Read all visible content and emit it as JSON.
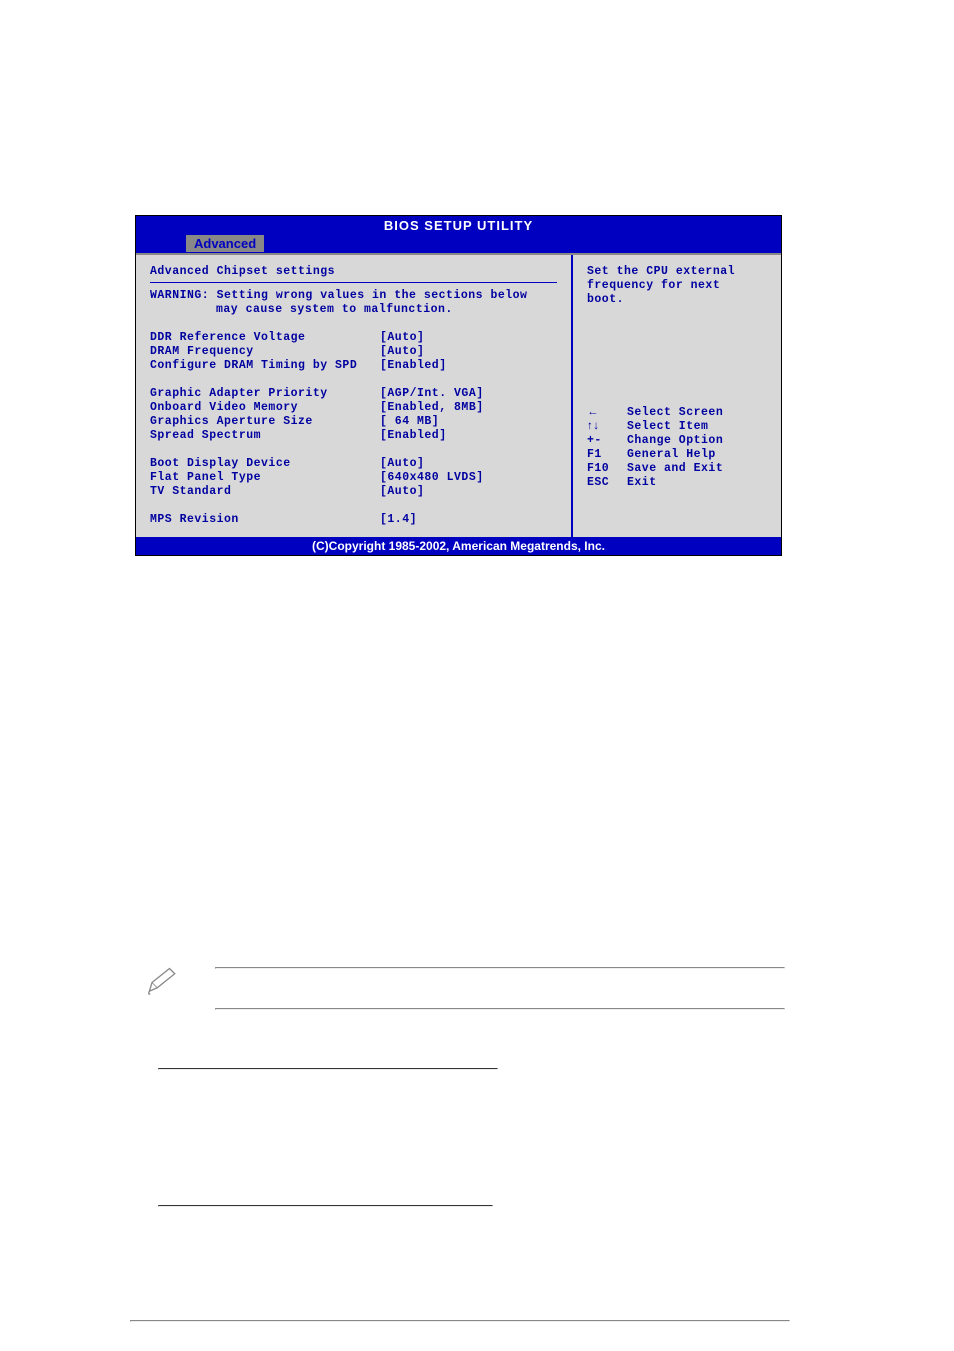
{
  "bios": {
    "title": "BIOS SETUP UTILITY",
    "tab": "Advanced",
    "footer": "(C)Copyright 1985-2002, American Megatrends, Inc.",
    "sectionTitle": "Advanced Chipset settings",
    "warning1": "WARNING: Setting wrong values in the sections below",
    "warning2": "may cause system to malfunction.",
    "settings": {
      "block1": [
        {
          "label": "DDR Reference Voltage",
          "value": "[Auto]"
        },
        {
          "label": "DRAM Frequency",
          "value": "[Auto]"
        },
        {
          "label": "Configure DRAM Timing by SPD",
          "value": "[Enabled]"
        }
      ],
      "block2": [
        {
          "label": "Graphic Adapter Priority",
          "value": "[AGP/Int. VGA]"
        },
        {
          "label": "Onboard Video Memory",
          "value": "[Enabled, 8MB]"
        },
        {
          "label": "Graphics Aperture Size",
          "value": "[ 64 MB]"
        },
        {
          "label": "Spread Spectrum",
          "value": "[Enabled]"
        }
      ],
      "block3": [
        {
          "label": "Boot Display Device",
          "value": "[Auto]"
        },
        {
          "label": "Flat Panel Type",
          "value": "[640x480 LVDS]"
        },
        {
          "label": "TV Standard",
          "value": "[Auto]"
        }
      ],
      "block4": [
        {
          "label": "MPS Revision",
          "value": "[1.4]"
        }
      ]
    },
    "help": {
      "line1": "Set the CPU external",
      "line2": "frequency for next",
      "line3": "boot."
    },
    "nav": [
      {
        "key": "←",
        "action": "Select Screen"
      },
      {
        "key": "↑↓",
        "action": "Select Item"
      },
      {
        "key": "+-",
        "action": "Change Option"
      },
      {
        "key": "F1",
        "action": "General Help"
      },
      {
        "key": "F10",
        "action": "Save and Exit"
      },
      {
        "key": "ESC",
        "action": "Exit"
      }
    ]
  }
}
